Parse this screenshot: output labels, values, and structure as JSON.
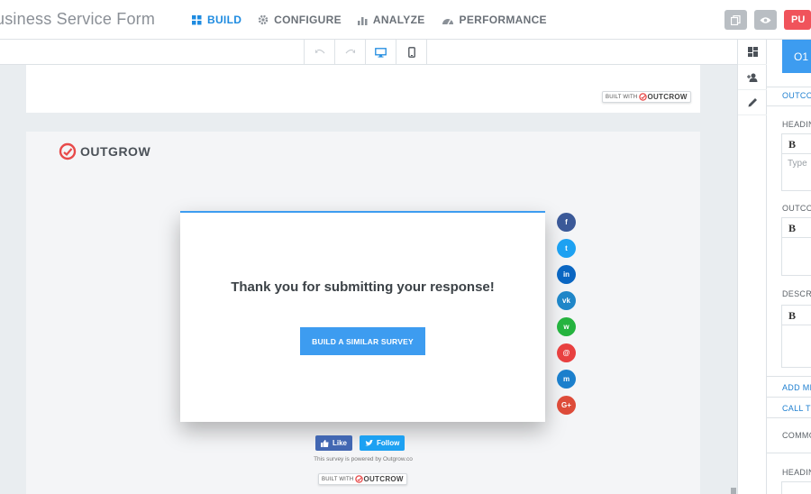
{
  "app": {
    "title": "usiness Service Form"
  },
  "nav": [
    {
      "label": "BUILD",
      "icon": "grid-icon",
      "active": true
    },
    {
      "label": "CONFIGURE",
      "icon": "gear-icon",
      "active": false
    },
    {
      "label": "ANALYZE",
      "icon": "bar-chart-icon",
      "active": false
    },
    {
      "label": "PERFORMANCE",
      "icon": "speedometer-icon",
      "active": false
    }
  ],
  "actions": {
    "publish_label": "PU"
  },
  "canvas": {
    "built_with_label": "BUILT WITH",
    "built_with_brand": "OUTCROW",
    "logo_text": "OUTGROW",
    "modal": {
      "title": "Thank you for submitting your response!",
      "cta_label": "BUILD A SIMILAR SURVEY"
    },
    "share_buttons": [
      {
        "name": "facebook",
        "glyph": "f",
        "color": "#3b5998"
      },
      {
        "name": "twitter",
        "glyph": "t",
        "color": "#1da1f2"
      },
      {
        "name": "linkedin",
        "glyph": "in",
        "color": "#0a66c2"
      },
      {
        "name": "vk",
        "glyph": "vk",
        "color": "#1f86c8"
      },
      {
        "name": "whatsapp",
        "glyph": "w",
        "color": "#25b33f"
      },
      {
        "name": "email",
        "glyph": "@",
        "color": "#e84040"
      },
      {
        "name": "messenger",
        "glyph": "m",
        "color": "#1b7fcc"
      },
      {
        "name": "google-plus",
        "glyph": "G+",
        "color": "#dd4b39"
      }
    ],
    "like_label": "Like",
    "follow_label": "Follow",
    "powered_text": "This survey is powered by Outgrow.co"
  },
  "panel": {
    "tab_label": "O1",
    "outcome_link": "OUTCO",
    "heading_label": "HEADIN",
    "bold_label": "B",
    "heading_placeholder": "Type",
    "outcome_label": "OUTCO",
    "description_label": "DESCR",
    "add_more_link": "ADD MI",
    "call_to_link": "CALL TO",
    "common_label": "COMMO",
    "heading2_label": "HEADIN"
  },
  "colors": {
    "accent": "#3d9cf0",
    "publish": "#f0535b",
    "brand": "#e84a4a"
  }
}
